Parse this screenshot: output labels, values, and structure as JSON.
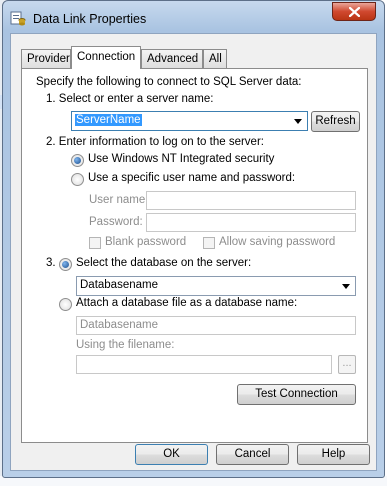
{
  "window": {
    "title": "Data Link Properties",
    "close_label": "close"
  },
  "tabs": [
    "Provider",
    "Connection",
    "Advanced",
    "All"
  ],
  "intro": "Specify the following to connect to SQL Server data:",
  "step1": {
    "label": "1. Select or enter a server name:",
    "server_value": "ServerName",
    "refresh_label": "Refresh"
  },
  "step2": {
    "label": "2. Enter information to log on to the server:",
    "option_nt": "Use Windows NT Integrated security",
    "option_user": "Use a specific user name and password:",
    "username_label": "User name:",
    "password_label": "Password:",
    "blank_password_label": "Blank password",
    "allow_saving_label": "Allow saving password"
  },
  "step3": {
    "number": "3.",
    "label": "Select the database on the server:",
    "database_value": "Databasename",
    "attach_label": "Attach a database file as a database name:",
    "attach_placeholder": "Databasename",
    "filename_label": "Using the filename:",
    "browse_label": "...",
    "test_label": "Test Connection"
  },
  "footer": {
    "ok": "OK",
    "cancel": "Cancel",
    "help": "Help"
  }
}
